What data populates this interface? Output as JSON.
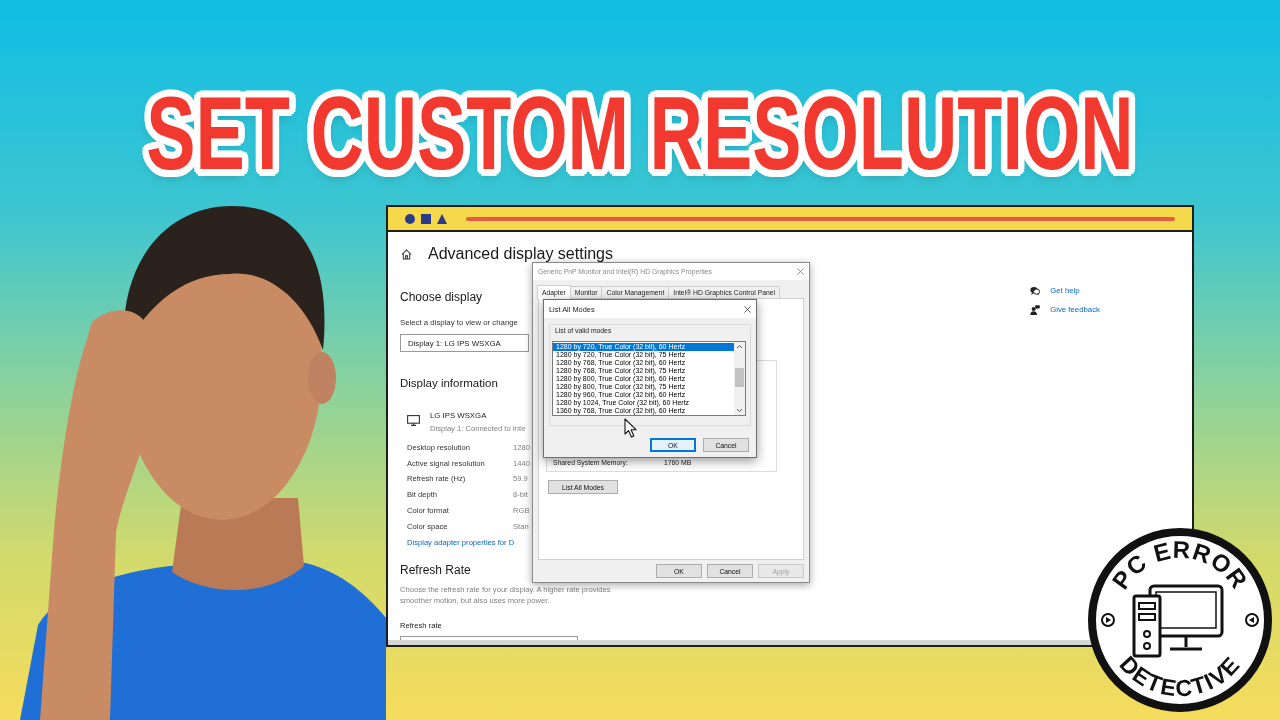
{
  "headline": "SET CUSTOM RESOLUTION",
  "settings": {
    "title": "Advanced display settings",
    "choose_display": {
      "heading": "Choose display",
      "hint": "Select a display to view or change",
      "dropdown_value": "Display 1: LG IPS WSXGA"
    },
    "display_information": {
      "heading": "Display information",
      "monitor_name": "LG IPS WSXGA",
      "monitor_status": "Display 1: Connected to Inte",
      "rows": [
        {
          "label": "Desktop resolution",
          "value": "1280"
        },
        {
          "label": "Active signal resolution",
          "value": "1440"
        },
        {
          "label": "Refresh rate (Hz)",
          "value": "59.9"
        },
        {
          "label": "Bit depth",
          "value": "8-bit"
        },
        {
          "label": "Color format",
          "value": "RGB"
        },
        {
          "label": "Color space",
          "value": "Stan"
        }
      ],
      "link": "Display adapter properties for D"
    },
    "refresh_rate": {
      "heading": "Refresh Rate",
      "description": "Choose the refresh rate for your display. A higher rate provides smoother motion, but also uses more power.",
      "field_label": "Refresh rate"
    },
    "help_links": [
      {
        "kind": "help",
        "label": "Get help"
      },
      {
        "kind": "feedback",
        "label": "Give feedback"
      }
    ]
  },
  "properties_dialog": {
    "title": "Generic PnP Monitor and Intel(R) HD Graphics Properties",
    "tabs": [
      {
        "label": "Adapter",
        "selected": true
      },
      {
        "label": "Monitor",
        "selected": false
      },
      {
        "label": "Color Management",
        "selected": false
      },
      {
        "label": "Intel® HD Graphics Control Panel",
        "selected": false
      }
    ],
    "memory_label": "Shared System Memory:",
    "memory_value": "1760 MB",
    "list_button": "List All Modes",
    "buttons": [
      {
        "label": "OK",
        "disabled": false
      },
      {
        "label": "Cancel",
        "disabled": false
      },
      {
        "label": "Apply",
        "disabled": true
      }
    ]
  },
  "modes_dialog": {
    "title": "List All Modes",
    "group_label": "List of valid modes",
    "modes": [
      {
        "label": "1280 by 720, True Color (32 bit), 60 Hertz",
        "selected": true
      },
      {
        "label": "1280 by 720, True Color (32 bit), 75 Hertz",
        "selected": false
      },
      {
        "label": "1280 by 768, True Color (32 bit), 60 Hertz",
        "selected": false
      },
      {
        "label": "1280 by 768, True Color (32 bit), 75 Hertz",
        "selected": false
      },
      {
        "label": "1280 by 800, True Color (32 bit), 60 Hertz",
        "selected": false
      },
      {
        "label": "1280 by 800, True Color (32 bit), 75 Hertz",
        "selected": false
      },
      {
        "label": "1280 by 960, True Color (32 bit), 60 Hertz",
        "selected": false
      },
      {
        "label": "1280 by 1024, True Color (32 bit), 60 Hertz",
        "selected": false
      },
      {
        "label": "1360 by 768, True Color (32 bit), 60 Hertz",
        "selected": false
      }
    ],
    "buttons": [
      {
        "label": "OK",
        "focused": true
      },
      {
        "label": "Cancel",
        "focused": false
      }
    ]
  },
  "logo": {
    "top_text": "PC ERROR",
    "bottom_text": "DETECTIVE"
  }
}
